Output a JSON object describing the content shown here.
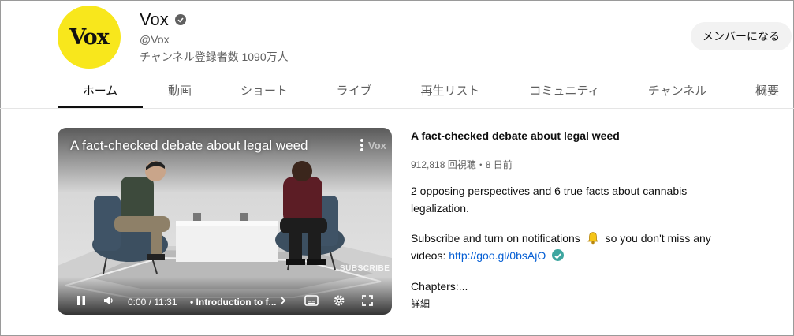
{
  "channel": {
    "avatar_text": "Vox",
    "name": "Vox",
    "handle": "@Vox",
    "subscribers": "チャンネル登録者数 1090万人",
    "member_button": "メンバーになる",
    "avatar_color": "#f8e71c"
  },
  "tabs": [
    {
      "label": "ホーム",
      "active": true
    },
    {
      "label": "動画",
      "active": false
    },
    {
      "label": "ショート",
      "active": false
    },
    {
      "label": "ライブ",
      "active": false
    },
    {
      "label": "再生リスト",
      "active": false
    },
    {
      "label": "コミュニティ",
      "active": false
    },
    {
      "label": "チャンネル",
      "active": false
    },
    {
      "label": "概要",
      "active": false
    }
  ],
  "player": {
    "overlay_title": "A fact-checked debate about legal weed",
    "watermark": "Vox",
    "subscribe_watermark": "SUBSCRIBE",
    "time": "0:00 / 11:31",
    "chapter": "• Introduction to f...",
    "icons": [
      "pause-icon",
      "volume-icon",
      "chevron-right-icon",
      "subtitles-icon",
      "settings-icon",
      "fullscreen-icon",
      "more-vert-icon"
    ]
  },
  "video": {
    "title": "A fact-checked debate about legal weed",
    "meta": "912,818 回視聴・8 日前",
    "desc_line1": "2 opposing perspectives and 6 true facts about cannabis legalization.",
    "desc_sub_prefix": "Subscribe and turn on notifications",
    "desc_sub_suffix": "so you don't miss any videos:",
    "link": "http://goo.gl/0bsAjO",
    "chapters": "Chapters:...",
    "more": "詳細"
  }
}
